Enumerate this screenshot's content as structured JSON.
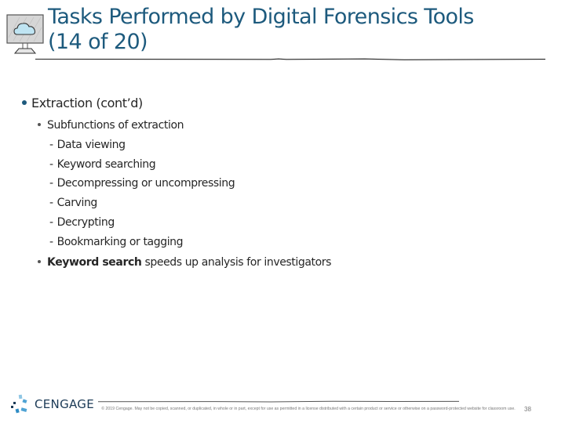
{
  "slide": {
    "title_line1": "Tasks Performed by Digital Forensics Tools",
    "title_line2": "(14 of 20)",
    "title_color": "#1d5a7d",
    "icon": "computer-monitor-cloud-icon"
  },
  "content": {
    "level1": {
      "text": "Extraction (cont’d)"
    },
    "subfunctions_heading": "Subfunctions of extraction",
    "subfunctions": [
      "Data viewing",
      "Keyword searching",
      "Decompressing or uncompressing",
      "Carving",
      "Decrypting",
      "Bookmarking or tagging"
    ],
    "dash": "-",
    "keyword_bullet": {
      "bold": "Keyword search",
      "rest": " speeds up analysis for investigators"
    }
  },
  "footer": {
    "logo_text": "CENGAGE",
    "logo_icon": "cengage-logo-mark-icon",
    "copyright": "© 2019 Cengage. May not be copied, scanned, or duplicated, in whole or in part, except for use as permitted in a license distributed with a certain product or service or otherwise on a password-protected website for classroom use.",
    "page_number": "38"
  }
}
